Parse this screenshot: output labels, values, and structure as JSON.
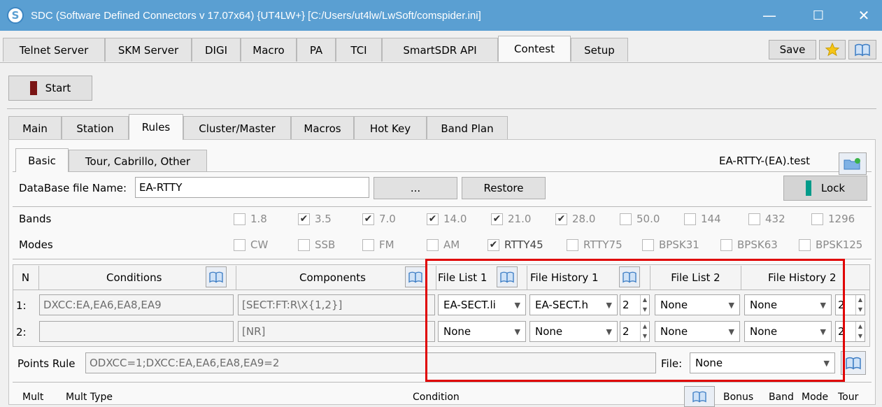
{
  "window": {
    "title": "SDC (Software Defined Connectors v 17.07x64) {UT4LW+} [C:/Users/ut4lw/LwSoft/comspider.ini]",
    "app_icon": "S",
    "minimize": "—",
    "maximize": "☐",
    "close": "✕"
  },
  "top_tabs": [
    "Telnet Server",
    "SKM Server",
    "DIGI",
    "Macro",
    "PA",
    "TCI",
    "SmartSDR API",
    "Contest",
    "Setup"
  ],
  "toolbar": {
    "save_label": "Save",
    "start_label": "Start"
  },
  "sub_tabs": [
    "Main",
    "Station",
    "Rules",
    "Cluster/Master",
    "Macros",
    "Hot Key",
    "Band Plan"
  ],
  "rule_tabs": [
    "Basic",
    "Tour, Cabrillo, Other"
  ],
  "file_title": "EA-RTTY-(EA).test",
  "database": {
    "label": "DataBase file Name:",
    "value": "EA-RTTY",
    "browse_label": "...",
    "restore_label": "Restore",
    "lock_label": "Lock"
  },
  "bands": {
    "label": "Bands",
    "items": [
      {
        "label": "1.8",
        "checked": false
      },
      {
        "label": "3.5",
        "checked": true
      },
      {
        "label": "7.0",
        "checked": true
      },
      {
        "label": "14.0",
        "checked": true
      },
      {
        "label": "21.0",
        "checked": true
      },
      {
        "label": "28.0",
        "checked": true
      },
      {
        "label": "50.0",
        "checked": false
      },
      {
        "label": "144",
        "checked": false
      },
      {
        "label": "432",
        "checked": false
      },
      {
        "label": "1296",
        "checked": false
      }
    ]
  },
  "modes": {
    "label": "Modes",
    "items": [
      {
        "label": "CW",
        "checked": false
      },
      {
        "label": "SSB",
        "checked": false
      },
      {
        "label": "FM",
        "checked": false
      },
      {
        "label": "AM",
        "checked": false
      },
      {
        "label": "RTTY45",
        "checked": true
      },
      {
        "label": "RTTY75",
        "checked": false
      },
      {
        "label": "BPSK31",
        "checked": false
      },
      {
        "label": "BPSK63",
        "checked": false
      },
      {
        "label": "BPSK125",
        "checked": false
      }
    ]
  },
  "cond_table": {
    "headers": [
      "N",
      "Conditions",
      "Components",
      "File List 1",
      "File History 1",
      "File List 2",
      "File History 2"
    ],
    "rows": [
      {
        "n": "1:",
        "condition": "DXCC:EA,EA6,EA8,EA9",
        "component": "[SECT:FT:R\\X{1,2}]",
        "file_list_1": "EA-SECT.li",
        "file_history_1": "EA-SECT.h",
        "spin_1": "2",
        "file_list_2": "None",
        "file_history_2": "None",
        "spin_2": "2"
      },
      {
        "n": "2:",
        "condition": "",
        "component": "[NR]",
        "file_list_1": "None",
        "file_history_1": "None",
        "spin_1": "2",
        "file_list_2": "None",
        "file_history_2": "None",
        "spin_2": "2"
      }
    ]
  },
  "points_rule": {
    "label": "Points Rule",
    "value": "ODXCC=1;DXCC:EA,EA6,EA8,EA9=2",
    "file_label": "File:",
    "file_value": "None"
  },
  "mult_header": [
    "Mult",
    "Mult Type",
    "Condition",
    "Bonus",
    "Band",
    "Mode",
    "Tour"
  ],
  "colors": {
    "titlebar": "#5a9fd2",
    "highlight": "#e00000",
    "lock_indicator": "#009b8a",
    "start_indicator": "#7a1414"
  }
}
